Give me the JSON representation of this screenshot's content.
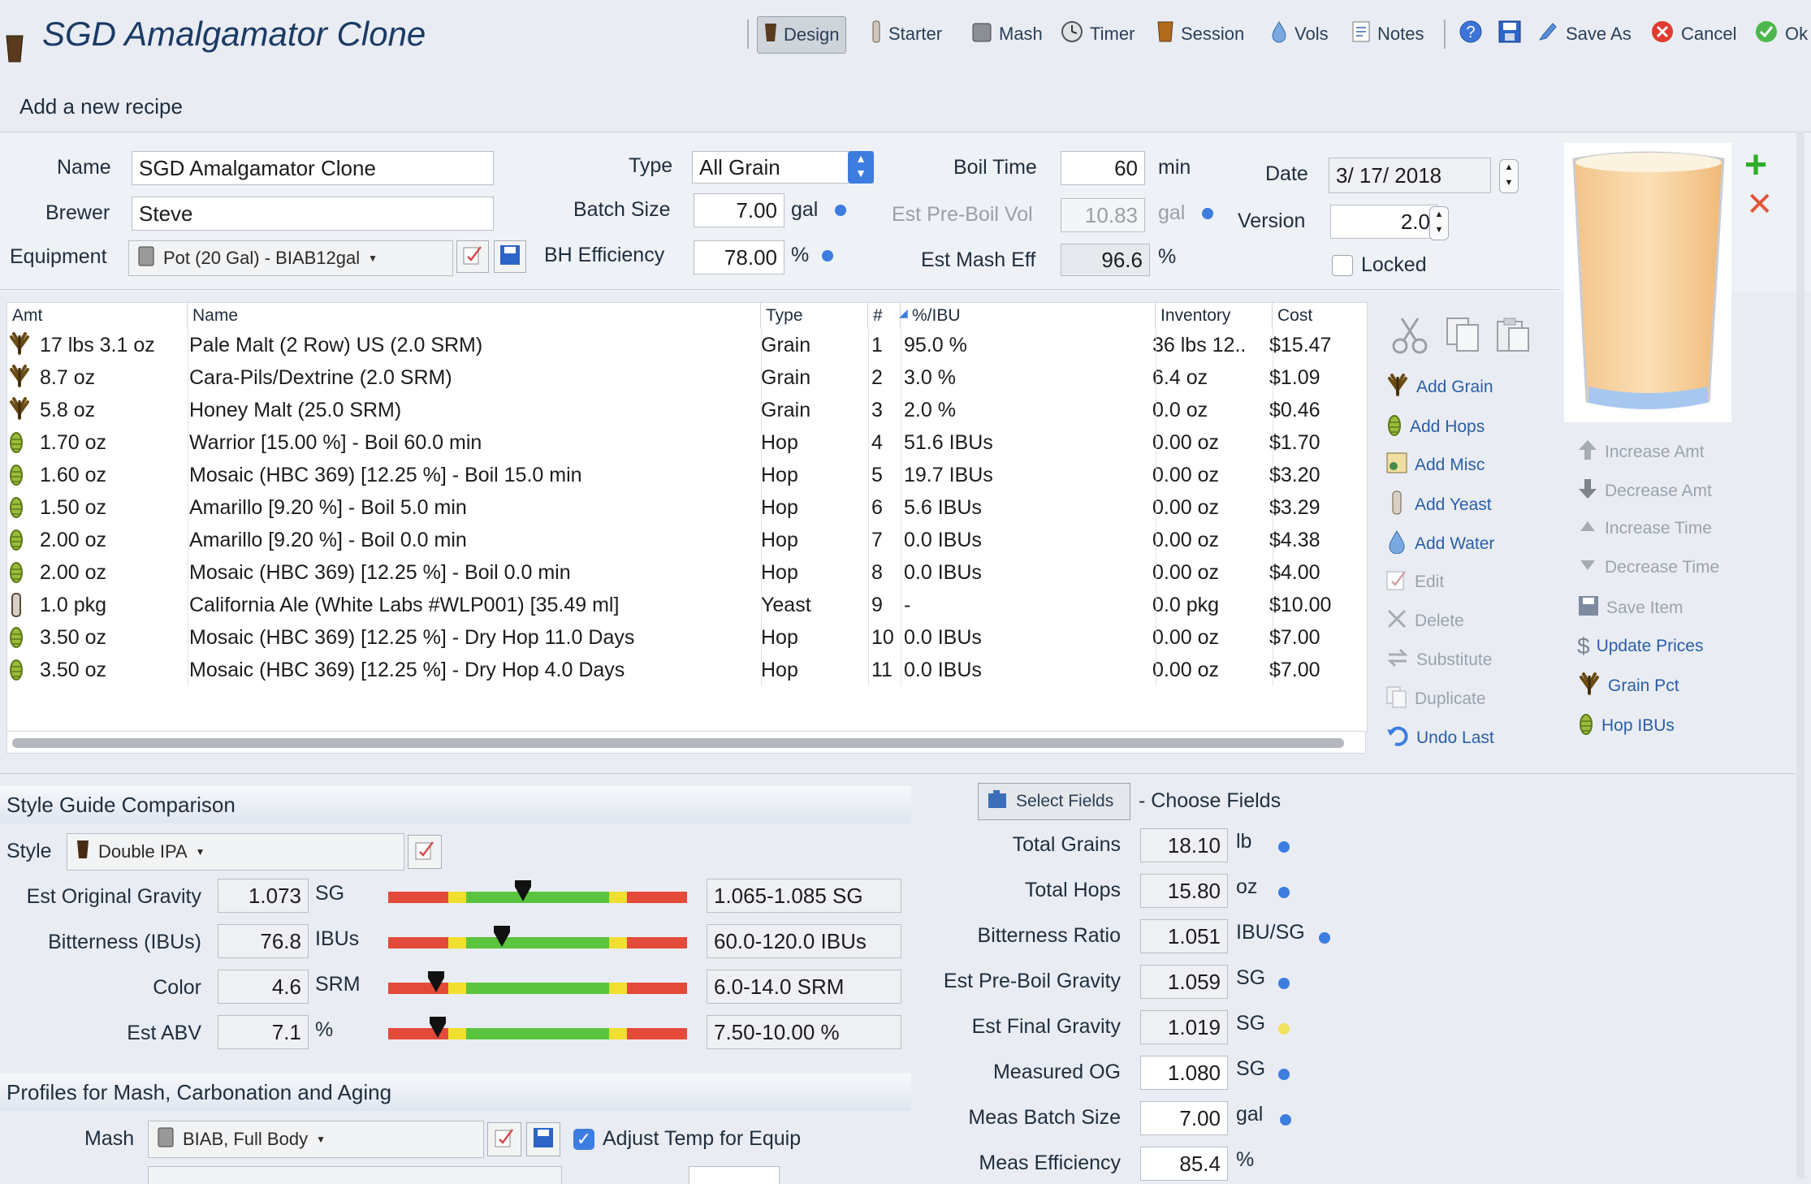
{
  "window": {
    "title": "SGD Amalgamator Clone",
    "subtitle": "Add a new recipe"
  },
  "toolbar": {
    "design": "Design",
    "starter": "Starter",
    "mash": "Mash",
    "timer": "Timer",
    "session": "Session",
    "vols": "Vols",
    "notes": "Notes",
    "save_as": "Save As",
    "cancel": "Cancel",
    "ok": "Ok"
  },
  "form": {
    "name_label": "Name",
    "name_value": "SGD Amalgamator Clone",
    "brewer_label": "Brewer",
    "brewer_value": "Steve",
    "equipment_label": "Equipment",
    "equipment_value": "Pot (20 Gal) - BIAB12gal",
    "type_label": "Type",
    "type_value": "All Grain",
    "batch_label": "Batch Size",
    "batch_value": "7.00",
    "batch_unit": "gal",
    "bh_label": "BH Efficiency",
    "bh_value": "78.00",
    "bh_unit": "%",
    "boil_label": "Boil Time",
    "boil_value": "60",
    "boil_unit": "min",
    "preboil_label": "Est Pre-Boil Vol",
    "preboil_value": "10.83",
    "preboil_unit": "gal",
    "mash_eff_label": "Est Mash Eff",
    "mash_eff_value": "96.6",
    "mash_eff_unit": "%",
    "date_label": "Date",
    "date_value": "3/ 17/ 2018",
    "version_label": "Version",
    "version_value": "2.0",
    "locked_label": "Locked"
  },
  "table": {
    "columns": [
      "Amt",
      "Name",
      "Type",
      "#",
      "%/IBU",
      "Inventory",
      "Cost"
    ],
    "rows": [
      {
        "icon": "grain",
        "amt": "17 lbs 3.1 oz",
        "name": "Pale Malt (2 Row) US (2.0 SRM)",
        "type": "Grain",
        "num": "1",
        "pct": "95.0 %",
        "inv": "36 lbs 12..",
        "cost": "$15.47"
      },
      {
        "icon": "grain",
        "amt": "8.7 oz",
        "name": "Cara-Pils/Dextrine (2.0 SRM)",
        "type": "Grain",
        "num": "2",
        "pct": "3.0 %",
        "inv": "6.4 oz",
        "cost": "$1.09"
      },
      {
        "icon": "grain",
        "amt": "5.8 oz",
        "name": "Honey Malt (25.0 SRM)",
        "type": "Grain",
        "num": "3",
        "pct": "2.0 %",
        "inv": "0.0 oz",
        "cost": "$0.46"
      },
      {
        "icon": "hop",
        "amt": "1.70 oz",
        "name": "Warrior [15.00 %] - Boil 60.0 min",
        "type": "Hop",
        "num": "4",
        "pct": "51.6 IBUs",
        "inv": "0.00 oz",
        "cost": "$1.70"
      },
      {
        "icon": "hop",
        "amt": "1.60 oz",
        "name": "Mosaic (HBC 369) [12.25 %] - Boil 15.0 min",
        "type": "Hop",
        "num": "5",
        "pct": "19.7 IBUs",
        "inv": "0.00 oz",
        "cost": "$3.20"
      },
      {
        "icon": "hop",
        "amt": "1.50 oz",
        "name": "Amarillo [9.20 %] - Boil 5.0 min",
        "type": "Hop",
        "num": "6",
        "pct": "5.6 IBUs",
        "inv": "0.00 oz",
        "cost": "$3.29"
      },
      {
        "icon": "hop",
        "amt": "2.00 oz",
        "name": "Amarillo [9.20 %] - Boil 0.0 min",
        "type": "Hop",
        "num": "7",
        "pct": "0.0 IBUs",
        "inv": "0.00 oz",
        "cost": "$4.38"
      },
      {
        "icon": "hop",
        "amt": "2.00 oz",
        "name": "Mosaic (HBC 369) [12.25 %] - Boil 0.0 min",
        "type": "Hop",
        "num": "8",
        "pct": "0.0 IBUs",
        "inv": "0.00 oz",
        "cost": "$4.00"
      },
      {
        "icon": "yeast",
        "amt": "1.0 pkg",
        "name": "California Ale (White Labs #WLP001) [35.49 ml]",
        "type": "Yeast",
        "num": "9",
        "pct": "-",
        "inv": "0.0 pkg",
        "cost": "$10.00"
      },
      {
        "icon": "hop",
        "amt": "3.50 oz",
        "name": "Mosaic (HBC 369) [12.25 %] - Dry Hop 11.0 Days",
        "type": "Hop",
        "num": "10",
        "pct": "0.0 IBUs",
        "inv": "0.00 oz",
        "cost": "$7.00"
      },
      {
        "icon": "hop",
        "amt": "3.50 oz",
        "name": "Mosaic (HBC 369) [12.25 %] - Dry Hop 4.0 Days",
        "type": "Hop",
        "num": "11",
        "pct": "0.0 IBUs",
        "inv": "0.00 oz",
        "cost": "$7.00"
      }
    ]
  },
  "actions": {
    "add_grain": "Add Grain",
    "add_hops": "Add Hops",
    "add_misc": "Add Misc",
    "add_yeast": "Add Yeast",
    "add_water": "Add Water",
    "edit": "Edit",
    "delete": "Delete",
    "substitute": "Substitute",
    "duplicate": "Duplicate",
    "undo_last": "Undo Last",
    "increase_amt": "Increase Amt",
    "decrease_amt": "Decrease Amt",
    "increase_time": "Increase Time",
    "decrease_time": "Decrease Time",
    "save_item": "Save Item",
    "update_prices": "Update Prices",
    "grain_pct": "Grain Pct",
    "hop_ibus": "Hop IBUs"
  },
  "style": {
    "section_title": "Style Guide Comparison",
    "style_label": "Style",
    "style_value": "Double IPA",
    "metrics": [
      {
        "label": "Est Original Gravity",
        "value": "1.073",
        "unit": "SG",
        "range": "1.065-1.085 SG",
        "level": 0.45
      },
      {
        "label": "Bitterness (IBUs)",
        "value": "76.8",
        "unit": "IBUs",
        "range": "60.0-120.0 IBUs",
        "level": 0.38
      },
      {
        "label": "Color",
        "value": "4.6",
        "unit": "SRM",
        "range": "6.0-14.0 SRM",
        "level": 0.16
      },
      {
        "label": "Est ABV",
        "value": "7.1",
        "unit": "%",
        "range": "7.50-10.00 %",
        "level": 0.165
      }
    ]
  },
  "profiles": {
    "section_title": "Profiles for Mash, Carbonation and Aging",
    "mash_label": "Mash",
    "mash_value": "BIAB, Full Body",
    "adjust_label": "Adjust Temp for Equip"
  },
  "stats": {
    "select_fields": "Select Fields",
    "choose_fields": "- Choose Fields",
    "items": [
      {
        "label": "Total Grains",
        "value": "18.10",
        "unit": "lb",
        "dot": "blue"
      },
      {
        "label": "Total Hops",
        "value": "15.80",
        "unit": "oz",
        "dot": "blue"
      },
      {
        "label": "Bitterness Ratio",
        "value": "1.051",
        "unit": "IBU/SG",
        "dot": "blue"
      },
      {
        "label": "Est Pre-Boil Gravity",
        "value": "1.059",
        "unit": "SG",
        "dot": "blue"
      },
      {
        "label": "Est Final Gravity",
        "value": "1.019",
        "unit": "SG",
        "dot": "yellow"
      },
      {
        "label": "Measured OG",
        "value": "1.080",
        "unit": "SG",
        "dot": "blue"
      },
      {
        "label": "Meas Batch Size",
        "value": "7.00",
        "unit": "gal",
        "dot": "blue"
      },
      {
        "label": "Meas Efficiency",
        "value": "85.4",
        "unit": "%",
        "dot": "none"
      }
    ]
  },
  "colors": {
    "accent": "#2a5ea8",
    "slider_red": "#e34a3a",
    "slider_yellow": "#f0df2e",
    "slider_green": "#5bc43f"
  }
}
